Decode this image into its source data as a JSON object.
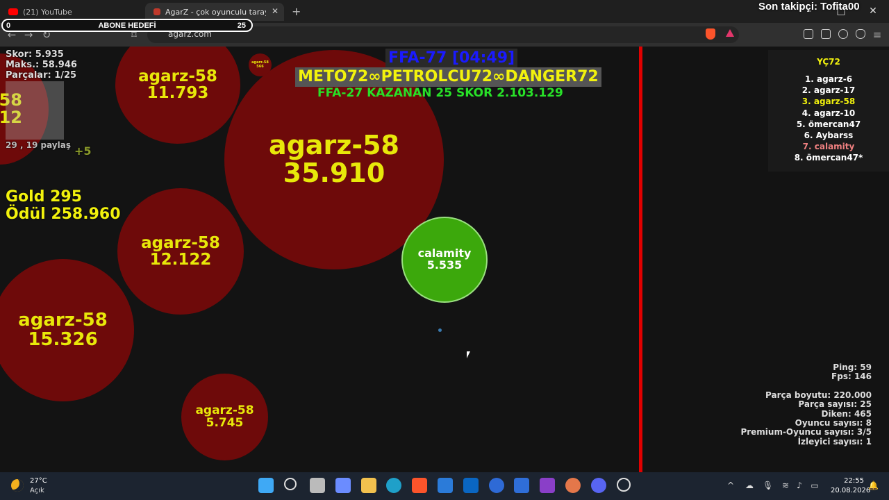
{
  "browser": {
    "tabs": [
      {
        "label": "(21) YouTube",
        "favicon_color": "#ff0000"
      },
      {
        "label": "AgarZ - çok oyunculu tarayıcı oy",
        "favicon_color": "#c0392b"
      }
    ],
    "new_tab": "+",
    "url": "agarz.com",
    "window_controls": [
      "–",
      "□",
      "✕"
    ]
  },
  "overlay": {
    "follower": "Son takipçi: Tofita00",
    "goal_min": "0",
    "goal_label": "ABONE HEDEFİ",
    "goal_max": "25"
  },
  "game": {
    "stats": {
      "score": "Skor: 5.935",
      "max": "Maks.: 58.946",
      "pieces": "Parçalar: 1/25"
    },
    "share": "29 , 19 paylaş",
    "plus": "+5",
    "gold": "Gold 295",
    "reward": "Ödül 258.960",
    "title": "FFA-77 [04:49]",
    "teams": "METO72∞PETROLCU72∞DANGER72",
    "winner": "FFA-27 KAZANAN 25 SKOR 2.103.129",
    "cells": [
      {
        "name": "agarz-58",
        "mass": "11.793"
      },
      {
        "name": "agarz-58",
        "mass": "35.910"
      },
      {
        "name": "agarz-58",
        "mass": "12.122"
      },
      {
        "name": "agarz-58",
        "mass": "15.326"
      },
      {
        "name": "agarz-58",
        "mass": "5.745"
      },
      {
        "name": "agarz-58",
        "mass": "566"
      },
      {
        "name": "calamity",
        "mass": "5.535"
      }
    ],
    "partial_cell": {
      "name": "-58",
      "mass": "12"
    },
    "leaderboard": {
      "title": "YÇ72",
      "rows": [
        "1. agarz-6",
        "2. agarz-17",
        "3. agarz-58",
        "4. agarz-10",
        "5. ömercan47",
        "6. Aybarss",
        "7. calamity",
        "8. ömercan47*"
      ]
    },
    "server": {
      "ping": "Ping: 59",
      "fps": "Fps: 146",
      "piece_size": "Parça boyutu: 220.000",
      "piece_count": "Parça sayısı: 25",
      "spikes": "Diken: 465",
      "players": "Oyuncu sayısı: 8",
      "premium": "Premium-Oyuncu sayısı: 3/5",
      "viewers": "İzleyici sayısı: 1"
    }
  },
  "taskbar": {
    "weather_temp": "27°C",
    "weather_desc": "Açık",
    "time": "22:55",
    "date": "20.08.2026"
  }
}
